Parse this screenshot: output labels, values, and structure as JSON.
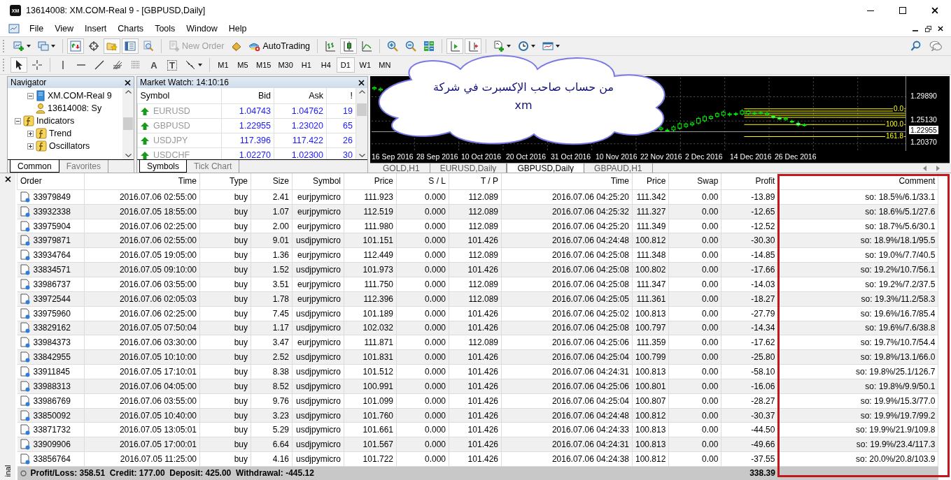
{
  "window": {
    "logo": "XM",
    "title": "13614008: XM.COM-Real 9 - [GBPUSD,Daily]"
  },
  "menu": [
    "File",
    "View",
    "Insert",
    "Charts",
    "Tools",
    "Window",
    "Help"
  ],
  "toolbar": {
    "tools": [
      {
        "kind": "new-chart",
        "pressed": false
      },
      {
        "kind": "profiles",
        "pressed": false
      },
      {
        "kind": "separator"
      },
      {
        "kind": "market-watch",
        "pressed": true
      },
      {
        "kind": "data-window",
        "pressed": false
      },
      {
        "kind": "navigator",
        "pressed": true
      },
      {
        "kind": "terminal",
        "pressed": true
      },
      {
        "kind": "tester",
        "pressed": false
      },
      {
        "kind": "separator"
      },
      {
        "kind": "new-order",
        "label": "New Order",
        "disabled": true
      },
      {
        "kind": "metaeditor",
        "pressed": false
      },
      {
        "kind": "autotrading",
        "label": "AutoTrading"
      },
      {
        "kind": "separator"
      },
      {
        "kind": "bar-chart",
        "pressed": false
      },
      {
        "kind": "candles",
        "pressed": true
      },
      {
        "kind": "line-chart",
        "pressed": false
      },
      {
        "kind": "separator"
      },
      {
        "kind": "zoom-in",
        "pressed": false
      },
      {
        "kind": "zoom-out",
        "pressed": false
      },
      {
        "kind": "tile",
        "pressed": false
      },
      {
        "kind": "separator"
      },
      {
        "kind": "autoscroll",
        "pressed": true
      },
      {
        "kind": "chart-shift",
        "pressed": true
      },
      {
        "kind": "separator"
      },
      {
        "kind": "indicators",
        "pressed": false
      },
      {
        "kind": "periods",
        "pressed": false
      },
      {
        "kind": "templates",
        "pressed": false
      }
    ]
  },
  "drawing_toolbar": {
    "tools": [
      {
        "kind": "cursor",
        "pressed": true
      },
      {
        "kind": "crosshair",
        "pressed": false
      },
      {
        "kind": "separator"
      },
      {
        "kind": "vline",
        "pressed": false
      },
      {
        "kind": "hline",
        "pressed": false
      },
      {
        "kind": "trendline",
        "pressed": false
      },
      {
        "kind": "fib-fan",
        "pressed": false
      },
      {
        "kind": "fib",
        "pressed": false
      },
      {
        "kind": "text",
        "label": "A"
      },
      {
        "kind": "label",
        "label": "T"
      },
      {
        "kind": "arrows",
        "pressed": false
      }
    ],
    "timeframes": [
      {
        "label": "M1",
        "selected": false
      },
      {
        "label": "M5",
        "selected": false
      },
      {
        "label": "M15",
        "selected": false
      },
      {
        "label": "M30",
        "selected": false
      },
      {
        "label": "H1",
        "selected": false
      },
      {
        "label": "H4",
        "selected": false
      },
      {
        "label": "D1",
        "selected": true
      },
      {
        "label": "W1",
        "selected": false
      },
      {
        "label": "MN",
        "selected": false
      }
    ]
  },
  "navigator": {
    "title": "Navigator",
    "tree": [
      {
        "label": "XM.COM-Real 9",
        "kind": "server",
        "expanded": true,
        "children": [
          {
            "label": "13614008: Sy",
            "kind": "account"
          }
        ]
      },
      {
        "label": "Indicators",
        "kind": "folder",
        "expanded": true,
        "children": [
          {
            "label": "Trend",
            "kind": "folder",
            "expanded": false
          },
          {
            "label": "Oscillators",
            "kind": "folder",
            "expanded": false
          }
        ]
      }
    ],
    "tabs": [
      {
        "label": "Common",
        "selected": true
      },
      {
        "label": "Favorites",
        "selected": false
      }
    ]
  },
  "market_watch": {
    "title": "Market Watch: 14:10:16",
    "columns": [
      "Symbol",
      "Bid",
      "Ask",
      "!"
    ],
    "rows": [
      {
        "symbol": "EURUSD",
        "bid": "1.04743",
        "ask": "1.04762",
        "spread": "19",
        "rising": true
      },
      {
        "symbol": "GBPUSD",
        "bid": "1.22955",
        "ask": "1.23020",
        "spread": "65",
        "rising": true
      },
      {
        "symbol": "USDJPY",
        "bid": "117.396",
        "ask": "117.422",
        "spread": "26",
        "rising": true
      },
      {
        "symbol": "USDCHF",
        "bid": "1.02270",
        "ask": "1.02300",
        "spread": "30",
        "rising": true
      }
    ],
    "tabs": [
      {
        "label": "Symbols",
        "selected": true
      },
      {
        "label": "Tick Chart",
        "selected": false
      }
    ]
  },
  "chart": {
    "price_labels": [
      {
        "label": "1.29890",
        "kind": "tick"
      },
      {
        "label": "1.25130",
        "kind": "tick"
      },
      {
        "label": "1.22955",
        "kind": "current"
      },
      {
        "label": "1.20370",
        "kind": "tick"
      }
    ],
    "fib_labels": [
      "0.0",
      "100.0",
      "161.8"
    ],
    "dates": [
      "16 Sep 2016",
      "28 Sep 2016",
      "10 Oct 2016",
      "20 Oct 2016",
      "31 Oct 2016",
      "10 Nov 2016",
      "22 Nov 2016",
      "2 Dec 2016",
      "14 Dec 2016",
      "26 Dec 2016"
    ],
    "tabs": [
      {
        "label": "GOLD,H1",
        "selected": false
      },
      {
        "label": "EURUSD,Daily",
        "selected": false
      },
      {
        "label": "GBPUSD,Daily",
        "selected": true
      },
      {
        "label": "GBPAUD,H1",
        "selected": false
      }
    ]
  },
  "callout": {
    "text": "من حساب صاحب الإكسبرت في شركة xm"
  },
  "terminal": {
    "side_label": "inal",
    "columns": [
      "Order",
      "Time",
      "Type",
      "Size",
      "Symbol",
      "Price",
      "S / L",
      "T / P",
      "Time",
      "Price",
      "Swap",
      "Profit",
      "Comment"
    ],
    "rows": [
      [
        "33979849",
        "2016.07.06 02:55:00",
        "buy",
        "2.41",
        "eurjpymicro",
        "111.923",
        "0.000",
        "112.089",
        "2016.07.06 04:25:20",
        "111.342",
        "0.00",
        "-13.89",
        "so: 18.5%/6.1/33.1"
      ],
      [
        "33932338",
        "2016.07.05 18:55:00",
        "buy",
        "1.07",
        "eurjpymicro",
        "112.519",
        "0.000",
        "112.089",
        "2016.07.06 04:25:32",
        "111.327",
        "0.00",
        "-12.65",
        "so: 18.6%/5.1/27.6"
      ],
      [
        "33975904",
        "2016.07.06 02:25:00",
        "buy",
        "2.00",
        "eurjpymicro",
        "111.980",
        "0.000",
        "112.089",
        "2016.07.06 04:25:20",
        "111.349",
        "0.00",
        "-12.52",
        "so: 18.7%/5.6/30.1"
      ],
      [
        "33979871",
        "2016.07.06 02:55:00",
        "buy",
        "9.01",
        "usdjpymicro",
        "101.151",
        "0.000",
        "101.426",
        "2016.07.06 04:24:48",
        "100.812",
        "0.00",
        "-30.30",
        "so: 18.9%/18.1/95.5"
      ],
      [
        "33934764",
        "2016.07.05 19:05:00",
        "buy",
        "1.36",
        "eurjpymicro",
        "112.449",
        "0.000",
        "112.089",
        "2016.07.06 04:25:08",
        "111.348",
        "0.00",
        "-14.85",
        "so: 19.0%/7.7/40.5"
      ],
      [
        "33834571",
        "2016.07.05 09:10:00",
        "buy",
        "1.52",
        "usdjpymicro",
        "101.973",
        "0.000",
        "101.426",
        "2016.07.06 04:25:08",
        "100.802",
        "0.00",
        "-17.66",
        "so: 19.2%/10.7/56.1"
      ],
      [
        "33986737",
        "2016.07.06 03:55:00",
        "buy",
        "3.51",
        "eurjpymicro",
        "111.750",
        "0.000",
        "112.089",
        "2016.07.06 04:25:08",
        "111.347",
        "0.00",
        "-14.03",
        "so: 19.2%/7.2/37.5"
      ],
      [
        "33972544",
        "2016.07.06 02:05:03",
        "buy",
        "1.78",
        "eurjpymicro",
        "112.396",
        "0.000",
        "112.089",
        "2016.07.06 04:25:05",
        "111.361",
        "0.00",
        "-18.27",
        "so: 19.3%/11.2/58.3"
      ],
      [
        "33975960",
        "2016.07.06 02:25:00",
        "buy",
        "7.45",
        "usdjpymicro",
        "101.189",
        "0.000",
        "101.426",
        "2016.07.06 04:25:02",
        "100.813",
        "0.00",
        "-27.79",
        "so: 19.6%/16.7/85.4"
      ],
      [
        "33829162",
        "2016.07.05 07:50:04",
        "buy",
        "1.17",
        "usdjpymicro",
        "102.032",
        "0.000",
        "101.426",
        "2016.07.06 04:25:08",
        "100.797",
        "0.00",
        "-14.34",
        "so: 19.6%/7.6/38.8"
      ],
      [
        "33984373",
        "2016.07.06 03:30:00",
        "buy",
        "3.47",
        "eurjpymicro",
        "111.871",
        "0.000",
        "112.089",
        "2016.07.06 04:25:06",
        "111.359",
        "0.00",
        "-17.62",
        "so: 19.7%/10.7/54.4"
      ],
      [
        "33842955",
        "2016.07.05 10:10:00",
        "buy",
        "2.52",
        "usdjpymicro",
        "101.831",
        "0.000",
        "101.426",
        "2016.07.06 04:25:04",
        "100.799",
        "0.00",
        "-25.80",
        "so: 19.8%/13.1/66.0"
      ],
      [
        "33911845",
        "2016.07.05 17:10:01",
        "buy",
        "8.38",
        "usdjpymicro",
        "101.512",
        "0.000",
        "101.426",
        "2016.07.06 04:24:31",
        "100.813",
        "0.00",
        "-58.10",
        "so: 19.8%/25.1/126.7"
      ],
      [
        "33988313",
        "2016.07.06 04:05:00",
        "buy",
        "8.52",
        "usdjpymicro",
        "100.991",
        "0.000",
        "101.426",
        "2016.07.06 04:25:06",
        "100.801",
        "0.00",
        "-16.06",
        "so: 19.8%/9.9/50.1"
      ],
      [
        "33986769",
        "2016.07.06 03:55:00",
        "buy",
        "9.76",
        "usdjpymicro",
        "101.099",
        "0.000",
        "101.426",
        "2016.07.06 04:25:04",
        "100.807",
        "0.00",
        "-28.27",
        "so: 19.9%/15.3/77.0"
      ],
      [
        "33850092",
        "2016.07.05 10:40:00",
        "buy",
        "3.23",
        "usdjpymicro",
        "101.760",
        "0.000",
        "101.426",
        "2016.07.06 04:24:48",
        "100.812",
        "0.00",
        "-30.37",
        "so: 19.9%/19.7/99.2"
      ],
      [
        "33871732",
        "2016.07.05 13:05:01",
        "buy",
        "5.29",
        "usdjpymicro",
        "101.661",
        "0.000",
        "101.426",
        "2016.07.06 04:24:33",
        "100.813",
        "0.00",
        "-44.50",
        "so: 19.9%/21.9/109.8"
      ],
      [
        "33909906",
        "2016.07.05 17:00:01",
        "buy",
        "6.64",
        "usdjpymicro",
        "101.567",
        "0.000",
        "101.426",
        "2016.07.06 04:24:31",
        "100.813",
        "0.00",
        "-49.66",
        "so: 19.9%/23.4/117.3"
      ],
      [
        "33856764",
        "2016.07.05 11:25:00",
        "buy",
        "4.16",
        "usdjpymicro",
        "101.722",
        "0.000",
        "101.426",
        "2016.07.06 04:24:38",
        "100.812",
        "0.00",
        "-37.55",
        "so: 20.0%/20.8/103.9"
      ]
    ],
    "summary": {
      "text": "Profit/Loss: 358.51  Credit: 177.00  Deposit: 425.00  Withdrawal: -445.12",
      "profit": "338.39"
    }
  }
}
